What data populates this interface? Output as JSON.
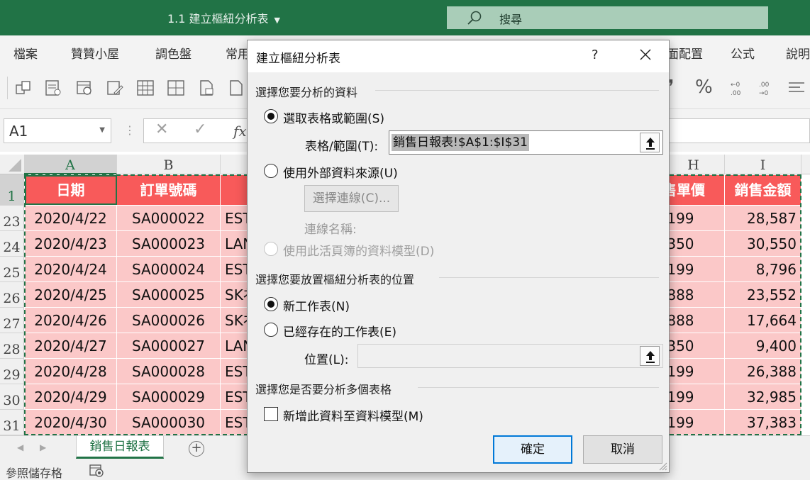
{
  "window": {
    "doc_title": "1.1 建立樞紐分析表",
    "search_label": "搜尋"
  },
  "menu": {
    "items_left": [
      "檔案",
      "贊贊小屋",
      "調色盤",
      "常用"
    ],
    "items_right": [
      "面配置",
      "公式",
      "說明"
    ]
  },
  "formula_bar": {
    "name_box": "A1",
    "fx_label": "fx"
  },
  "sheet": {
    "col_headers": [
      "A",
      "B",
      "H",
      "I"
    ],
    "header_row_number": "1",
    "headers": {
      "A": "日期",
      "B": "訂單號碼",
      "H": "售單價",
      "I": "銷售金額"
    },
    "rows": [
      {
        "num": "23",
        "date": "2020/4/22",
        "order": "SA000022",
        "product": "EST",
        "price": ",199",
        "amount": "28,587"
      },
      {
        "num": "24",
        "date": "2020/4/23",
        "order": "SA000023",
        "product": "LAN",
        "price": ",350",
        "amount": "30,550"
      },
      {
        "num": "25",
        "date": "2020/4/24",
        "order": "SA000024",
        "product": "EST",
        "price": ",199",
        "amount": "8,796"
      },
      {
        "num": "26",
        "date": "2020/4/25",
        "order": "SA000025",
        "product": "SK衤",
        "price": ",888",
        "amount": "23,552"
      },
      {
        "num": "27",
        "date": "2020/4/26",
        "order": "SA000026",
        "product": "SK衤",
        "price": ",888",
        "amount": "17,664"
      },
      {
        "num": "28",
        "date": "2020/4/27",
        "order": "SA000027",
        "product": "LAN",
        "price": ",350",
        "amount": "9,400"
      },
      {
        "num": "29",
        "date": "2020/4/28",
        "order": "SA000028",
        "product": "EST",
        "price": ",199",
        "amount": "26,388"
      },
      {
        "num": "30",
        "date": "2020/4/29",
        "order": "SA000029",
        "product": "EST",
        "price": ",199",
        "amount": "32,985"
      },
      {
        "num": "31",
        "date": "2020/4/30",
        "order": "SA000030",
        "product": "EST",
        "price": ",199",
        "amount": "37,383"
      }
    ],
    "tab_name": "銷售日報表",
    "add_sheet": "+"
  },
  "status": {
    "text": "參照儲存格"
  },
  "dialog": {
    "title": "建立樞紐分析表",
    "help": "?",
    "section_data": "選擇您要分析的資料",
    "opt_range": "選取表格或範圍(S)",
    "range_label": "表格/範圍(T):",
    "range_value": "銷售日報表!$A$1:$I$31",
    "opt_external": "使用外部資料來源(U)",
    "choose_connection": "選擇連線(C)...",
    "connection_name_label": "連線名稱:",
    "opt_data_model": "使用此活頁簿的資料模型(D)",
    "section_location": "選擇您要放置樞紐分析表的位置",
    "opt_new_sheet": "新工作表(N)",
    "opt_existing_sheet": "已經存在的工作表(E)",
    "location_label": "位置(L):",
    "location_value": "",
    "section_multi": "選擇您是否要分析多個表格",
    "add_to_model": "新增此資料至資料模型(M)",
    "ok": "確定",
    "cancel": "取消"
  },
  "colors": {
    "excel_green": "#217346",
    "header_red": "#f85a5a",
    "row_pink": "#fbc8c8",
    "focus_blue": "#0078d7"
  }
}
